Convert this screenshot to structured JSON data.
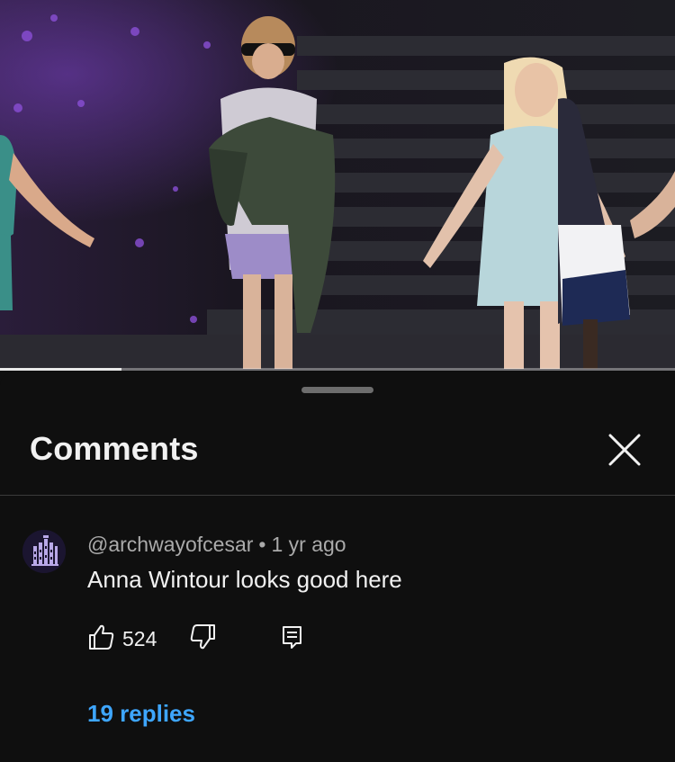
{
  "video": {
    "progress_fraction": 0.18
  },
  "comments_panel": {
    "title": "Comments",
    "close_icon": "close-icon",
    "comment": {
      "author": "@archwayofcesar",
      "separator": "•",
      "time": "1 yr ago",
      "text": "Anna Wintour looks good here",
      "like_count": "524",
      "icons": [
        "thumbs-up-icon",
        "thumbs-down-icon",
        "reply-icon"
      ],
      "replies_label": "19 replies"
    }
  },
  "colors": {
    "background": "#0f0f0f",
    "primary_text": "#f1f1f1",
    "secondary_text": "#aaaaaa",
    "link_blue": "#3ea6ff",
    "divider": "#3a3a3a"
  }
}
